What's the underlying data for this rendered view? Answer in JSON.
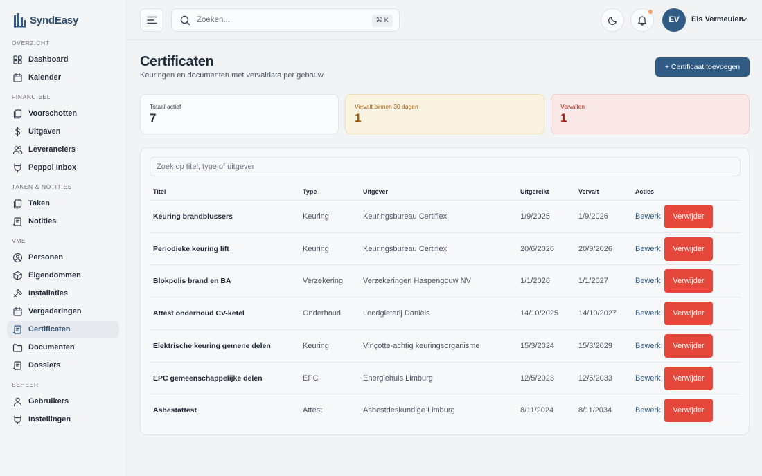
{
  "app": {
    "name": "SyndEasy",
    "accent": "#2f5b85"
  },
  "sidebar": {
    "sections": [
      {
        "title": "OVERZICHT",
        "items": [
          {
            "label": "Dashboard",
            "icon": "dashboard-icon"
          },
          {
            "label": "Kalender",
            "icon": "calendar-icon"
          }
        ]
      },
      {
        "title": "FINANCIEEL",
        "items": [
          {
            "label": "Voorschotten",
            "icon": "copy-icon"
          },
          {
            "label": "Uitgaven",
            "icon": "dollar-icon"
          },
          {
            "label": "Leveranciers",
            "icon": "users-icon"
          },
          {
            "label": "Peppol Inbox",
            "icon": "plug-icon"
          }
        ]
      },
      {
        "title": "TAKEN & NOTITIES",
        "items": [
          {
            "label": "Taken",
            "icon": "copy-icon"
          },
          {
            "label": "Notities",
            "icon": "note-icon"
          }
        ]
      },
      {
        "title": "VME",
        "items": [
          {
            "label": "Personen",
            "icon": "user-circle-icon"
          },
          {
            "label": "Eigendommen",
            "icon": "box-icon"
          },
          {
            "label": "Installaties",
            "icon": "wrench-icon"
          },
          {
            "label": "Vergaderingen",
            "icon": "calendar-icon"
          },
          {
            "label": "Certificaten",
            "icon": "note-icon",
            "active": true
          },
          {
            "label": "Documenten",
            "icon": "folder-icon"
          },
          {
            "label": "Dossiers",
            "icon": "note-icon"
          }
        ]
      },
      {
        "title": "BEHEER",
        "items": [
          {
            "label": "Gebruikers",
            "icon": "user-icon"
          },
          {
            "label": "Instellingen",
            "icon": "plug-icon"
          }
        ]
      }
    ]
  },
  "topbar": {
    "search_placeholder": "Zoeken...",
    "shortcut": "⌘ K",
    "user_initials": "EV",
    "user_name": "Els Vermeulen"
  },
  "page": {
    "title": "Certificaten",
    "subtitle": "Keuringen en documenten met vervaldata per gebouw.",
    "add_button": "+ Certificaat toevoegen"
  },
  "stats": [
    {
      "label": "Totaal actief",
      "value": "7"
    },
    {
      "label": "Vervalt binnen 30 dagen",
      "value": "1"
    },
    {
      "label": "Vervallen",
      "value": "1"
    }
  ],
  "table": {
    "filter_placeholder": "Zoek op titel, type of uitgever",
    "headers": [
      "Titel",
      "Type",
      "Uitgever",
      "Uitgereikt",
      "Vervalt",
      "Acties"
    ],
    "edit_label": "Bewerk",
    "delete_label": "Verwijder",
    "rows": [
      {
        "title": "Keuring brandblussers",
        "type": "Keuring",
        "issuer": "Keuringsbureau Certiflex",
        "issued": "1/9/2025",
        "expires": "1/9/2026"
      },
      {
        "title": "Periodieke keuring lift",
        "type": "Keuring",
        "issuer": "Keuringsbureau Certiflex",
        "issued": "20/6/2026",
        "expires": "20/9/2026"
      },
      {
        "title": "Blokpolis brand en BA",
        "type": "Verzekering",
        "issuer": "Verzekeringen Haspengouw NV",
        "issued": "1/1/2026",
        "expires": "1/1/2027"
      },
      {
        "title": "Attest onderhoud CV-ketel",
        "type": "Onderhoud",
        "issuer": "Loodgieterij Daniëls",
        "issued": "14/10/2025",
        "expires": "14/10/2027"
      },
      {
        "title": "Elektrische keuring gemene delen",
        "type": "Keuring",
        "issuer": "Vinçotte-achtig keuringsorganisme",
        "issued": "15/3/2024",
        "expires": "15/3/2029"
      },
      {
        "title": "EPC gemeenschappelijke delen",
        "type": "EPC",
        "issuer": "Energiehuis Limburg",
        "issued": "12/5/2023",
        "expires": "12/5/2033"
      },
      {
        "title": "Asbestattest",
        "type": "Attest",
        "issuer": "Asbestdeskundige Limburg",
        "issued": "8/11/2024",
        "expires": "8/11/2034"
      }
    ]
  }
}
